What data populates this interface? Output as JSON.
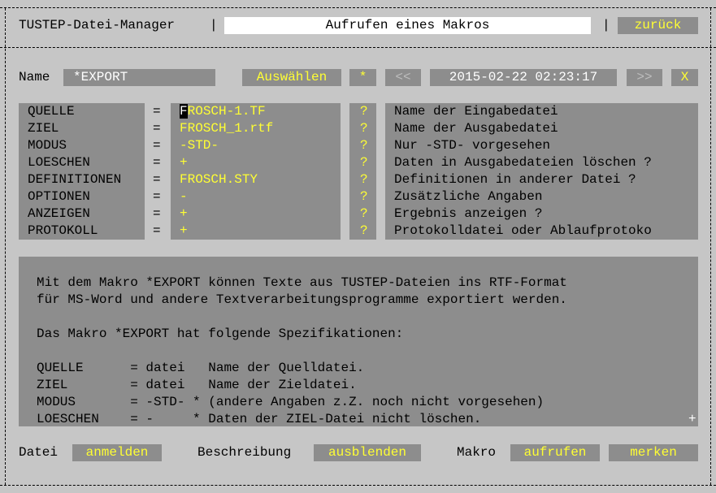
{
  "header": {
    "app_title": "TUSTEP-Datei-Manager",
    "screen_title": "Aufrufen eines Makros",
    "back_label": "zurück"
  },
  "name_row": {
    "label": "Name",
    "value": "*EXPORT",
    "select_label": "Auswählen",
    "star_label": "*",
    "prev_label": "<<",
    "datetime": "2015-02-22 02:23:17",
    "next_label": ">>",
    "close_label": "X"
  },
  "params": [
    {
      "name": "QUELLE",
      "eq": "=",
      "value": "FROSCH-1.TF",
      "help": "?",
      "description": "Name der Eingabedatei"
    },
    {
      "name": "ZIEL",
      "eq": "=",
      "value": "FROSCH_1.rtf",
      "help": "?",
      "description": "Name der Ausgabedatei"
    },
    {
      "name": "MODUS",
      "eq": "=",
      "value": "-STD-",
      "help": "?",
      "description": "Nur -STD- vorgesehen"
    },
    {
      "name": "LOESCHEN",
      "eq": "=",
      "value": "+",
      "help": "?",
      "description": "Daten in Ausgabedateien löschen ?"
    },
    {
      "name": "DEFINITIONEN",
      "eq": "=",
      "value": "FROSCH.STY",
      "help": "?",
      "description": "Definitionen in anderer Datei ?"
    },
    {
      "name": "OPTIONEN",
      "eq": "=",
      "value": "-",
      "help": "?",
      "description": "Zusätzliche Angaben"
    },
    {
      "name": "ANZEIGEN",
      "eq": "=",
      "value": "+",
      "help": "?",
      "description": "Ergebnis anzeigen ?"
    },
    {
      "name": "PROTOKOLL",
      "eq": "=",
      "value": "+",
      "help": "?",
      "description": "Protokolldatei oder Ablaufprotoko"
    }
  ],
  "description_text": [
    "Mit dem Makro *EXPORT können Texte aus TUSTEP-Dateien ins RTF-Format",
    "für MS-Word und andere Textverarbeitungsprogramme exportiert werden.",
    "",
    "Das Makro *EXPORT hat folgende Spezifikationen:",
    "",
    "QUELLE      = datei   Name der Quelldatei.",
    "ZIEL        = datei   Name der Zieldatei.",
    "MODUS       = -STD- * (andere Angaben z.Z. noch nicht vorgesehen)",
    "LOESCHEN    = -     * Daten der ZIEL-Datei nicht löschen."
  ],
  "scroll_marker": "+",
  "footer": {
    "file_label": "Datei",
    "register_label": "anmelden",
    "description_label": "Beschreibung",
    "hide_label": "ausblenden",
    "macro_label": "Makro",
    "call_label": "aufrufen",
    "remember_label": "merken"
  },
  "colors": {
    "background": "#c6c6c6",
    "field": "#8d8d8d",
    "accent": "#ffff33",
    "text": "#000000",
    "value_text": "#ffffff"
  }
}
